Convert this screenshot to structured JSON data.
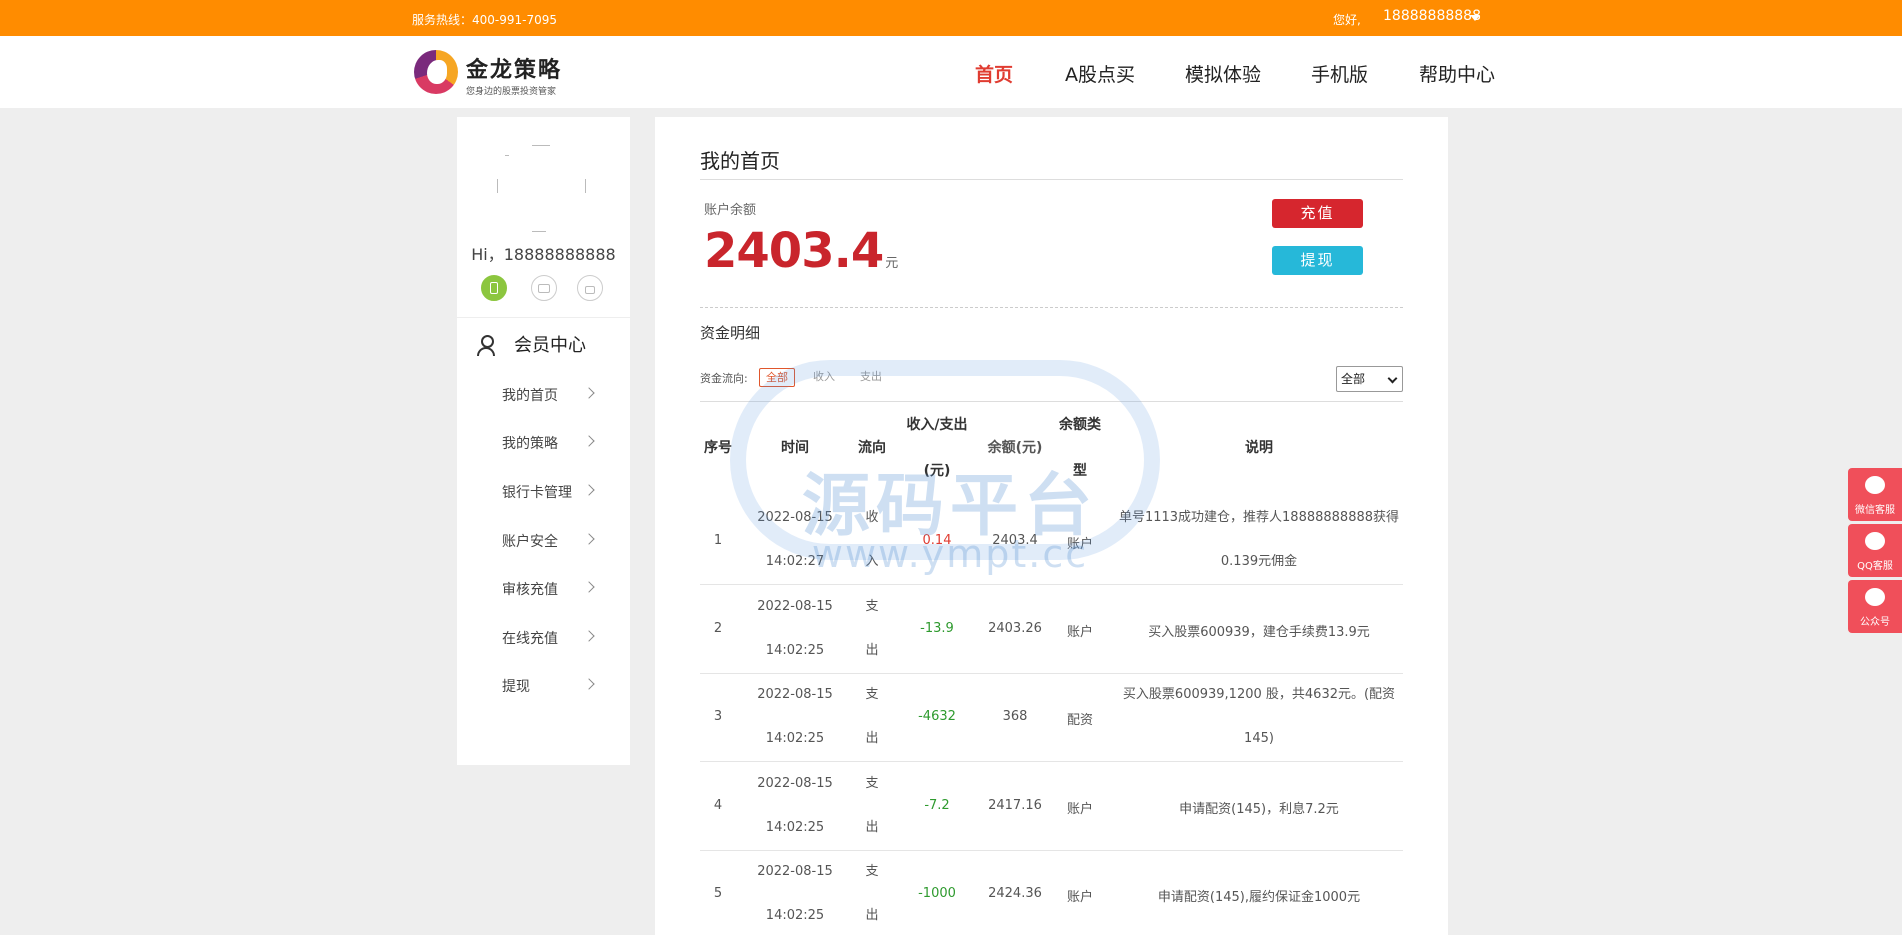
{
  "topbar": {
    "hotline": "服务热线：400-991-7095",
    "hello": "您好,",
    "user": "18888888888"
  },
  "logo": {
    "title": "金龙策略",
    "subtitle": "您身边的股票投资管家"
  },
  "nav": {
    "items": [
      {
        "label": "首页",
        "active": true
      },
      {
        "label": "A股点买"
      },
      {
        "label": "模拟体验"
      },
      {
        "label": "手机版"
      },
      {
        "label": "帮助中心"
      }
    ]
  },
  "sidebar": {
    "greeting": "Hi，18888888888",
    "member_title": "会员中心",
    "items": [
      {
        "label": "我的首页"
      },
      {
        "label": "我的策略"
      },
      {
        "label": "银行卡管理"
      },
      {
        "label": "账户安全"
      },
      {
        "label": "审核充值"
      },
      {
        "label": "在线充值"
      },
      {
        "label": "提现"
      }
    ]
  },
  "main": {
    "title": "我的首页",
    "balance_label": "账户余额",
    "balance_value": "2403.4",
    "balance_unit": "元",
    "recharge_label": "充值",
    "withdraw_label": "提现",
    "section_title": "资金明细",
    "flow_label": "资金流向:",
    "filters": [
      "全部",
      "收入",
      "支出"
    ],
    "select_value": "全部"
  },
  "table": {
    "headers": {
      "index": "序号",
      "time": "时间",
      "flow": "流向",
      "amount_1": "收入/支出",
      "amount_2": "(元)",
      "balance": "余额(元)",
      "type_1": "余额类",
      "type_2": "型",
      "desc": "说明"
    },
    "rows": [
      {
        "no": "1",
        "date": "2022-08-15",
        "time": "14:02:27",
        "flow_1": "收",
        "flow_2": "入",
        "amount": "0.14",
        "balance": "2403.4",
        "type": "账户",
        "desc_1": "单号1113成功建仓，推荐人18888888888获得",
        "desc_2": "0.139元佣金"
      },
      {
        "no": "2",
        "date": "2022-08-15",
        "time": "14:02:25",
        "flow_1": "支",
        "flow_2": "出",
        "amount": "-13.9",
        "balance": "2403.26",
        "type": "账户",
        "desc_1": "买入股票600939，建仓手续费13.9元",
        "desc_2": ""
      },
      {
        "no": "3",
        "date": "2022-08-15",
        "time": "14:02:25",
        "flow_1": "支",
        "flow_2": "出",
        "amount": "-4632",
        "balance": "368",
        "type": "配资",
        "desc_1": "买入股票600939,1200 股，共4632元。(配资",
        "desc_2": "145)"
      },
      {
        "no": "4",
        "date": "2022-08-15",
        "time": "14:02:25",
        "flow_1": "支",
        "flow_2": "出",
        "amount": "-7.2",
        "balance": "2417.16",
        "type": "账户",
        "desc_1": "申请配资(145)，利息7.2元",
        "desc_2": ""
      },
      {
        "no": "5",
        "date": "2022-08-15",
        "time": "14:02:25",
        "flow_1": "支",
        "flow_2": "出",
        "amount": "-1000",
        "balance": "2424.36",
        "type": "账户",
        "desc_1": "申请配资(145),履约保证金1000元",
        "desc_2": ""
      }
    ]
  },
  "watermark": {
    "text": "源码平台",
    "url": "www.ympt.cc"
  },
  "float": {
    "items": [
      {
        "label": "微信客服"
      },
      {
        "label": "QQ客服"
      },
      {
        "label": "公众号"
      }
    ]
  },
  "colors": {
    "topbar": "#ff8c00",
    "accent_red": "#d6262e",
    "accent_cyan": "#26b8d9",
    "income": "#e03c31",
    "expense": "#2e9a2e"
  }
}
